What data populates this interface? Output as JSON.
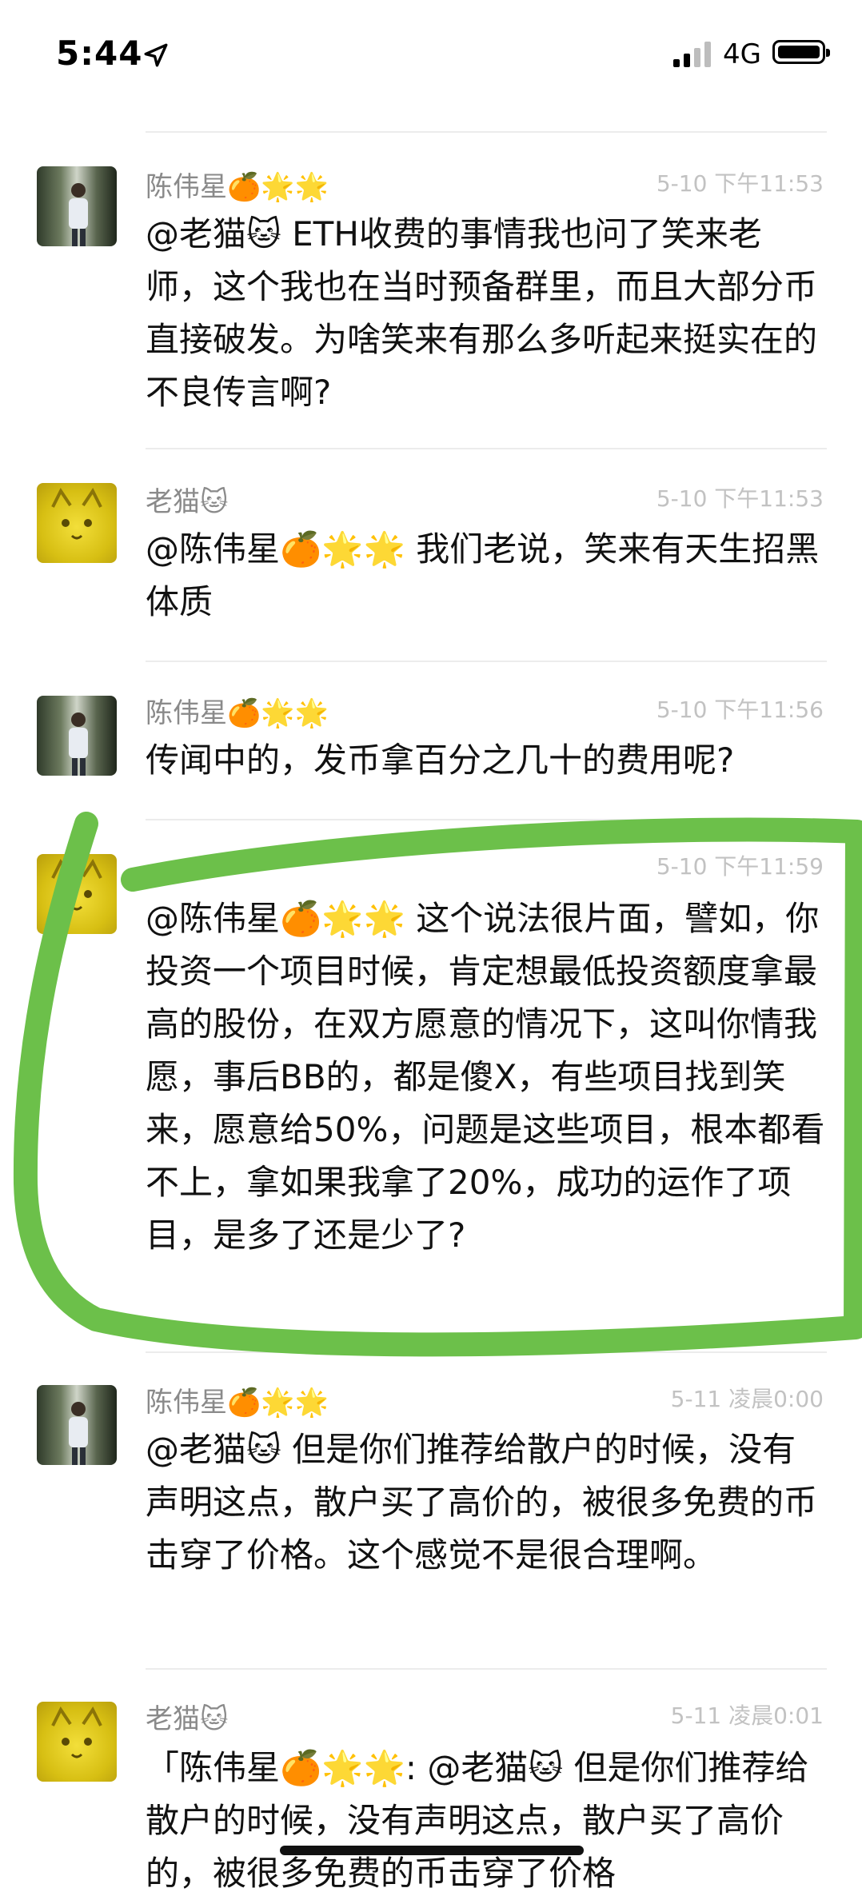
{
  "status_bar": {
    "time": "5:44",
    "network": "4G"
  },
  "messages": [
    {
      "sender": "陈伟星🍊🌟🌟",
      "timestamp": "5-10 下午11:53",
      "text": "@老猫🐱 ETH收费的事情我也问了笑来老师，这个我也在当时预备群里，而且大部分币直接破发。为啥笑来有那么多听起来挺实在的不良传言啊?"
    },
    {
      "sender": "老猫🐱",
      "timestamp": "5-10 下午11:53",
      "text": "@陈伟星🍊🌟🌟 我们老说，笑来有天生招黑体质"
    },
    {
      "sender": "陈伟星🍊🌟🌟",
      "timestamp": "5-10 下午11:56",
      "text": "传闻中的，发币拿百分之几十的费用呢?"
    },
    {
      "sender": "",
      "timestamp": "5-10 下午11:59",
      "text": "@陈伟星🍊🌟🌟 这个说法很片面，譬如，你投资一个项目时候，肯定想最低投资额度拿最高的股份，在双方愿意的情况下，这叫你情我愿，事后BB的，都是傻X，有些项目找到笑来，愿意给50%，问题是这些项目，根本都看不上，拿如果我拿了20%，成功的运作了项目，是多了还是少了?"
    },
    {
      "sender": "陈伟星🍊🌟🌟",
      "timestamp": "5-11 凌晨0:00",
      "text": "@老猫🐱 但是你们推荐给散户的时候，没有声明这点，散户买了高价的，被很多免费的币击穿了价格。这个感觉不是很合理啊。"
    },
    {
      "sender": "老猫🐱",
      "timestamp": "5-11 凌晨0:01",
      "text": "「陈伟星🍊🌟🌟: @老猫🐱 但是你们推荐给散户的时候，没有声明这点，散户买了高价的，被很多免费的币击穿了价格"
    }
  ],
  "colors": {
    "highlight": "#6cc04a",
    "timestamp": "#c2c2c2",
    "name": "#8a8a8a"
  }
}
